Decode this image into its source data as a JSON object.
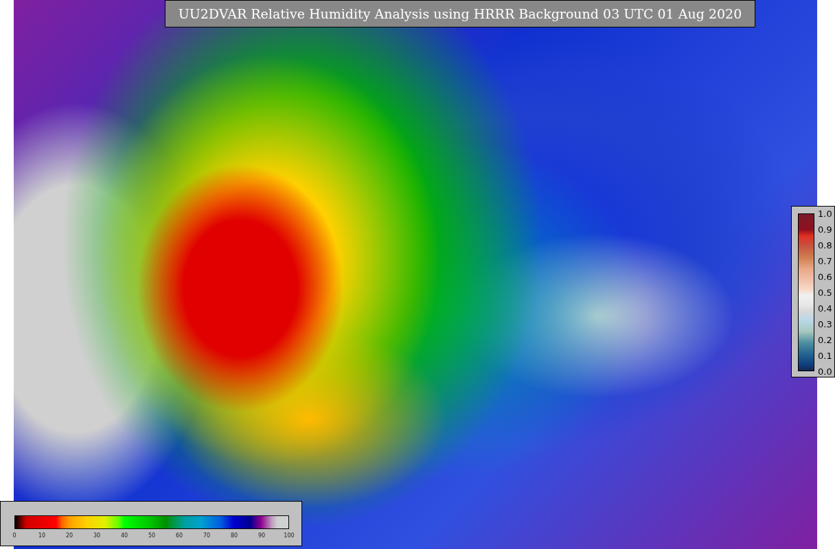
{
  "title": "UU2DVAR Relative Humidity Analysis using HRRR Background 03 UTC 01 Aug 2020",
  "humidity_colorbar": {
    "ticks": [
      "0",
      "10",
      "20",
      "30",
      "40",
      "50",
      "60",
      "70",
      "80",
      "90",
      "100"
    ]
  },
  "ratio_colorbar": {
    "ticks": [
      "1.0",
      "0.9",
      "0.8",
      "0.7",
      "0.6",
      "0.5",
      "0.4",
      "0.3",
      "0.2",
      "0.1",
      "0.0"
    ]
  }
}
